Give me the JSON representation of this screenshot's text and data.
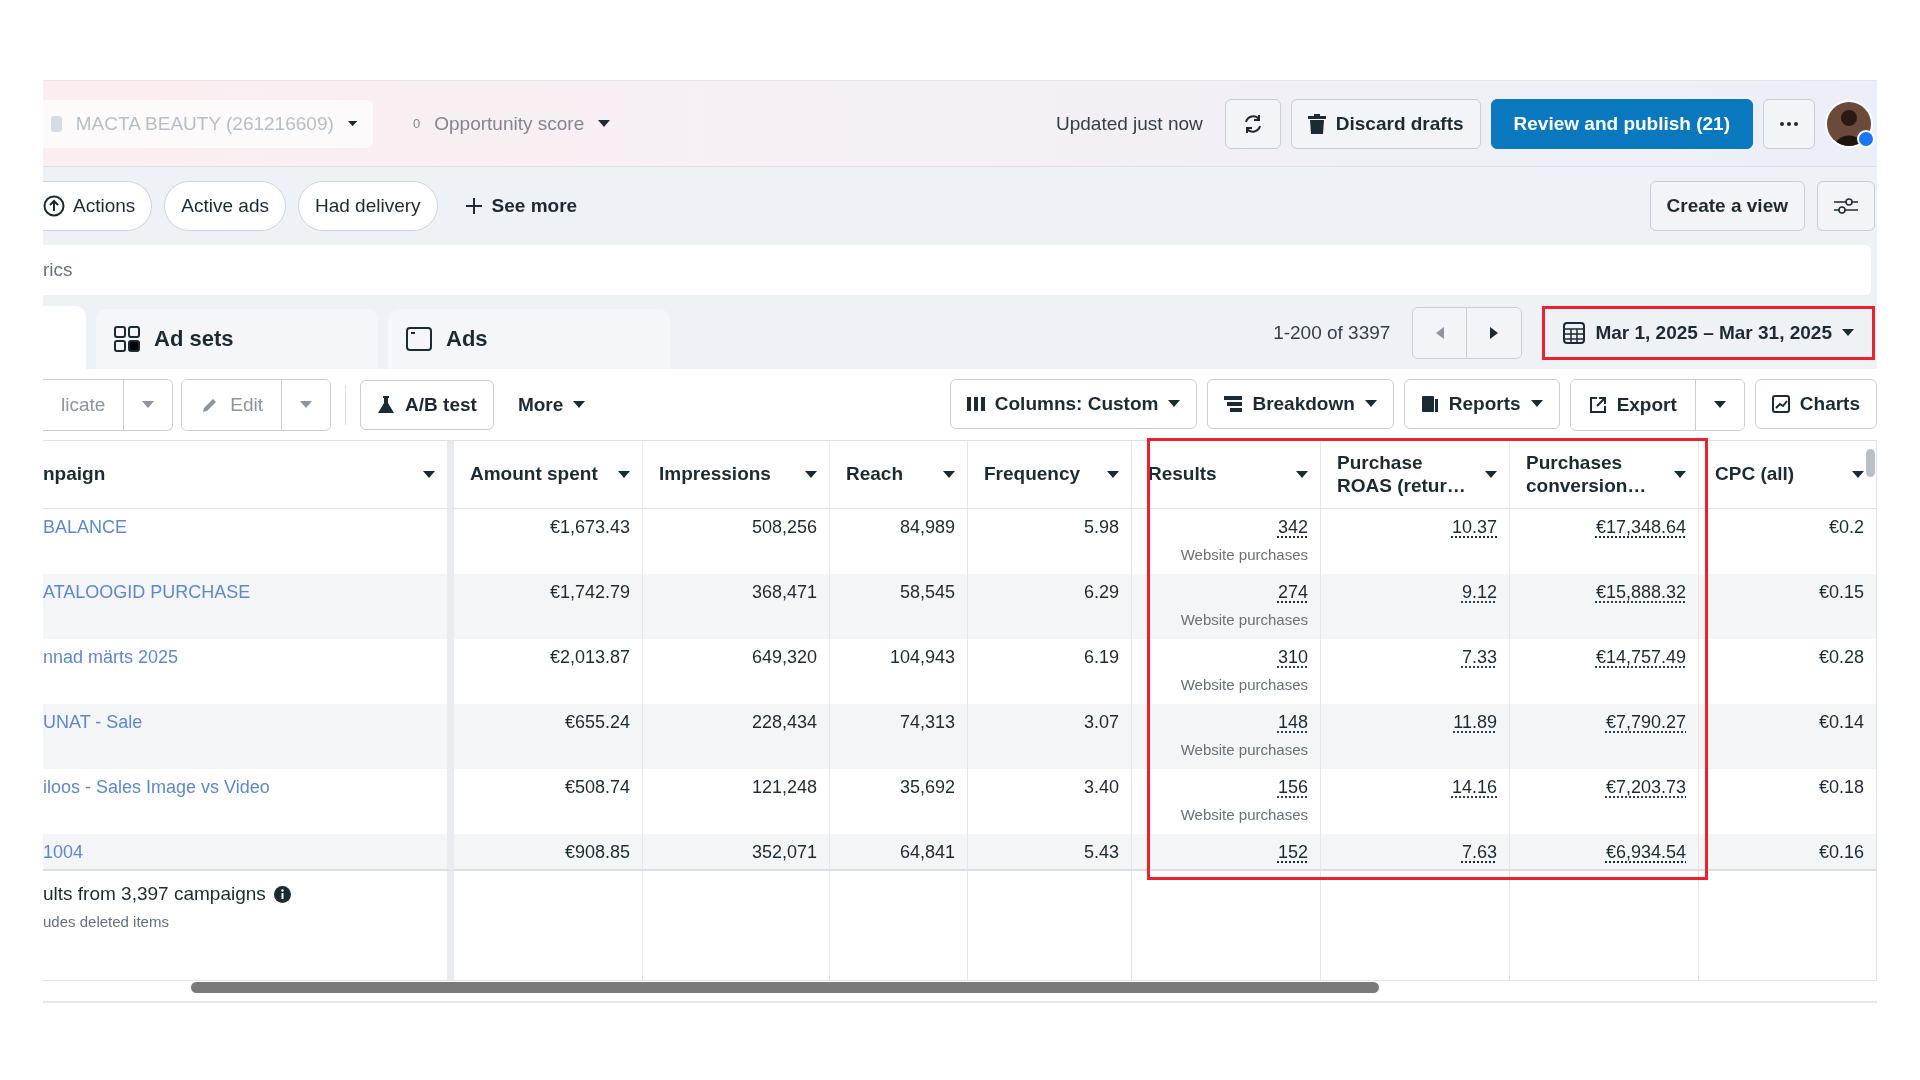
{
  "account": {
    "name": "MACTA BEAUTY (261216609)"
  },
  "opportunity": {
    "score": "0",
    "label": "Opportunity score"
  },
  "status": "Updated just now",
  "header_buttons": {
    "discard": "Discard drafts",
    "publish": "Review and publish (21)"
  },
  "filters": [
    {
      "label": "Actions",
      "kind": "icon"
    },
    {
      "label": "Active ads",
      "kind": "pill"
    },
    {
      "label": "Had delivery",
      "kind": "pill"
    },
    {
      "label": "See more",
      "kind": "add"
    }
  ],
  "create_view": "Create a view",
  "search": {
    "placeholder": "rics"
  },
  "tabs": [
    {
      "label": "Ad sets",
      "selected": false
    },
    {
      "label": "Ads",
      "selected": false
    }
  ],
  "pagination": "1-200 of 3397",
  "date_range": "Mar 1, 2025 – Mar 31, 2025",
  "toolbar_left": [
    {
      "label": "licate",
      "kind": "split",
      "disabled": true
    },
    {
      "label": "Edit",
      "kind": "split",
      "disabled": true
    },
    {
      "label": "A/B test",
      "kind": "button",
      "disabled": false
    },
    {
      "label": "More",
      "kind": "menu",
      "disabled": false
    }
  ],
  "toolbar_right": [
    {
      "label": "Columns: Custom",
      "kind": "menu"
    },
    {
      "label": "Breakdown",
      "kind": "menu"
    },
    {
      "label": "Reports",
      "kind": "menu"
    },
    {
      "label": "Export",
      "kind": "split"
    },
    {
      "label": "Charts",
      "kind": "button"
    }
  ],
  "table": {
    "columns": [
      "npaign",
      "Amount spent",
      "Impressions",
      "Reach",
      "Frequency",
      "Results",
      "Purchase ROAS (retur…",
      "Purchases conversion…",
      "CPC (all)"
    ],
    "rows": [
      {
        "name": "BALANCE",
        "amount": "€1,673.43",
        "impressions": "508,256",
        "reach": "84,989",
        "frequency": "5.98",
        "results": "342",
        "results_note": "Website purchases",
        "roas": "10.37",
        "conversion": "€17,348.64",
        "cpc": "€0.2"
      },
      {
        "name": "ATALOOGID PURCHASE",
        "amount": "€1,742.79",
        "impressions": "368,471",
        "reach": "58,545",
        "frequency": "6.29",
        "results": "274",
        "results_note": "Website purchases",
        "roas": "9.12",
        "conversion": "€15,888.32",
        "cpc": "€0.15"
      },
      {
        "name": "nnad märts 2025",
        "amount": "€2,013.87",
        "impressions": "649,320",
        "reach": "104,943",
        "frequency": "6.19",
        "results": "310",
        "results_note": "Website purchases",
        "roas": "7.33",
        "conversion": "€14,757.49",
        "cpc": "€0.28"
      },
      {
        "name": "UNAT - Sale",
        "amount": "€655.24",
        "impressions": "228,434",
        "reach": "74,313",
        "frequency": "3.07",
        "results": "148",
        "results_note": "Website purchases",
        "roas": "11.89",
        "conversion": "€7,790.27",
        "cpc": "€0.14"
      },
      {
        "name": "iloos - Sales Image vs Video",
        "amount": "€508.74",
        "impressions": "121,248",
        "reach": "35,692",
        "frequency": "3.40",
        "results": "156",
        "results_note": "Website purchases",
        "roas": "14.16",
        "conversion": "€7,203.73",
        "cpc": "€0.18"
      },
      {
        "name": "1004",
        "amount": "€908.85",
        "impressions": "352,071",
        "reach": "64,841",
        "frequency": "5.43",
        "results": "152",
        "roas": "7.63",
        "conversion": "€6,934.54",
        "cpc": "€0.16"
      }
    ]
  },
  "footer": {
    "summary": "ults from 3,397 campaigns",
    "note": "udes deleted items"
  }
}
